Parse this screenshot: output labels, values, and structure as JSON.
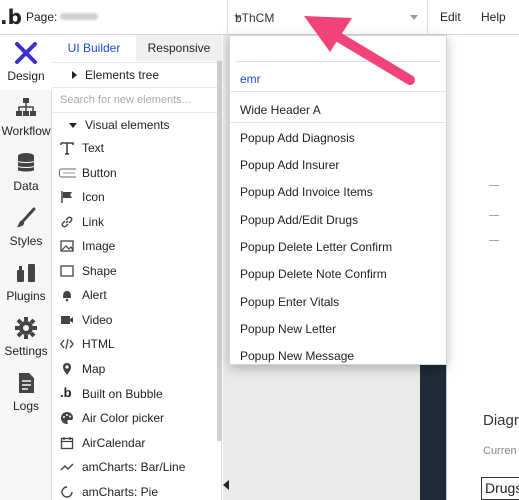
{
  "topbar": {
    "page_label": "Page:",
    "element_selected": "bThCM",
    "menu_edit": "Edit",
    "menu_help": "Help"
  },
  "rail": [
    {
      "label": "Design",
      "icon": "design-icon",
      "active": true
    },
    {
      "label": "Workflow",
      "icon": "workflow-icon"
    },
    {
      "label": "Data",
      "icon": "database-icon"
    },
    {
      "label": "Styles",
      "icon": "brush-icon"
    },
    {
      "label": "Plugins",
      "icon": "plugin-icon"
    },
    {
      "label": "Settings",
      "icon": "gear-icon"
    },
    {
      "label": "Logs",
      "icon": "logs-icon"
    }
  ],
  "panel": {
    "tab_ui": "UI Builder",
    "tab_responsive": "Responsive",
    "elements_tree": "Elements tree",
    "search_placeholder": "Search for new elements...",
    "visual_elements": "Visual elements",
    "elements": [
      {
        "label": "Text",
        "icon": "text-icon"
      },
      {
        "label": "Button",
        "icon": "button-icon"
      },
      {
        "label": "Icon",
        "icon": "flag-icon"
      },
      {
        "label": "Link",
        "icon": "link-icon"
      },
      {
        "label": "Image",
        "icon": "image-icon"
      },
      {
        "label": "Shape",
        "icon": "shape-icon"
      },
      {
        "label": "Alert",
        "icon": "bell-icon"
      },
      {
        "label": "Video",
        "icon": "video-icon"
      },
      {
        "label": "HTML",
        "icon": "code-icon"
      },
      {
        "label": "Map",
        "icon": "map-pin-icon"
      },
      {
        "label": "Built on Bubble",
        "icon": "bubble-logo-icon"
      },
      {
        "label": "Air Color picker",
        "icon": "palette-icon"
      },
      {
        "label": "AirCalendar",
        "icon": "calendar-icon"
      },
      {
        "label": "amCharts: Bar/Line",
        "icon": "line-chart-icon"
      },
      {
        "label": "amCharts: Pie",
        "icon": "pie-chart-icon"
      }
    ]
  },
  "dropdown": {
    "items": [
      "emr",
      "Wide Header A",
      "Popup Add Diagnosis",
      "Popup Add Insurer",
      "Popup Add Invoice Items",
      "Popup Add/Edit Drugs",
      "Popup Delete Letter Confirm",
      "Popup Delete Note Confirm",
      "Popup Enter Vitals",
      "Popup New Letter",
      "Popup New Message"
    ]
  },
  "canvas": {
    "heading": "Diagr",
    "subtext": "Curren",
    "box_text": "Drugs"
  },
  "colors": {
    "accent_blue": "#1a4fd6",
    "arrow_pink": "#f0437a",
    "design_icon": "#3b2fd0"
  }
}
